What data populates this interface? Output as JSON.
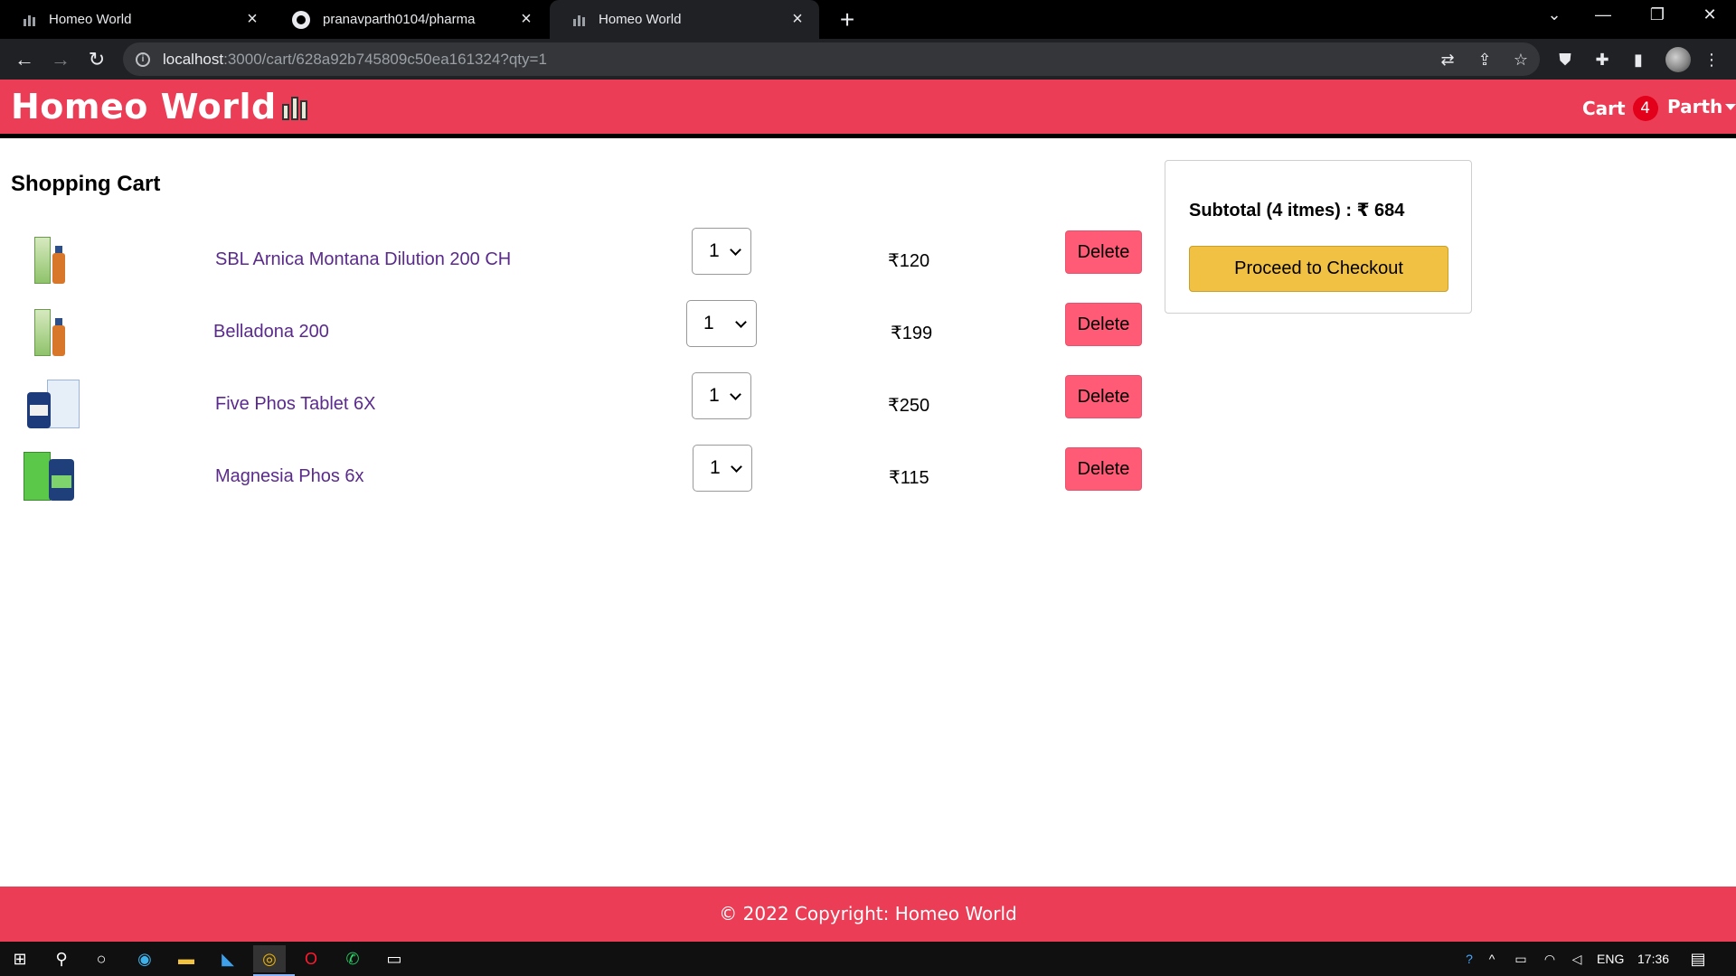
{
  "browser": {
    "tabs": [
      {
        "title": "Homeo World",
        "active": false
      },
      {
        "title": "pranavparth0104/pharma",
        "active": false
      },
      {
        "title": "Homeo World",
        "active": true
      }
    ],
    "url_host": "localhost",
    "url_path": ":3000/cart/628a92b745809c50ea161324?qty=1"
  },
  "header": {
    "brand": "Homeo World",
    "cart_label": "Cart",
    "cart_count": "4",
    "user_name": "Parth"
  },
  "page": {
    "title": "Shopping Cart"
  },
  "cart": {
    "items": [
      {
        "name": "SBL Arnica Montana Dilution 200 CH",
        "qty": "1",
        "price": "₹120",
        "delete_label": "Delete"
      },
      {
        "name": "Belladona 200",
        "qty": "1",
        "price": "₹199",
        "delete_label": "Delete"
      },
      {
        "name": "Five Phos Tablet 6X",
        "qty": "1",
        "price": "₹250",
        "delete_label": "Delete"
      },
      {
        "name": "Magnesia Phos 6x",
        "qty": "1",
        "price": "₹115",
        "delete_label": "Delete"
      }
    ]
  },
  "summary": {
    "subtotal_text": "Subtotal (4 itmes) : ₹ 684",
    "checkout_label": "Proceed to Checkout"
  },
  "footer": {
    "text": "© 2022 Copyright: Homeo World"
  },
  "taskbar": {
    "language": "ENG",
    "time": "17:36"
  },
  "colors": {
    "brand": "#ec3d56",
    "delete": "#ff5a76",
    "checkout": "#f0c143",
    "link": "#5a2a8c"
  }
}
